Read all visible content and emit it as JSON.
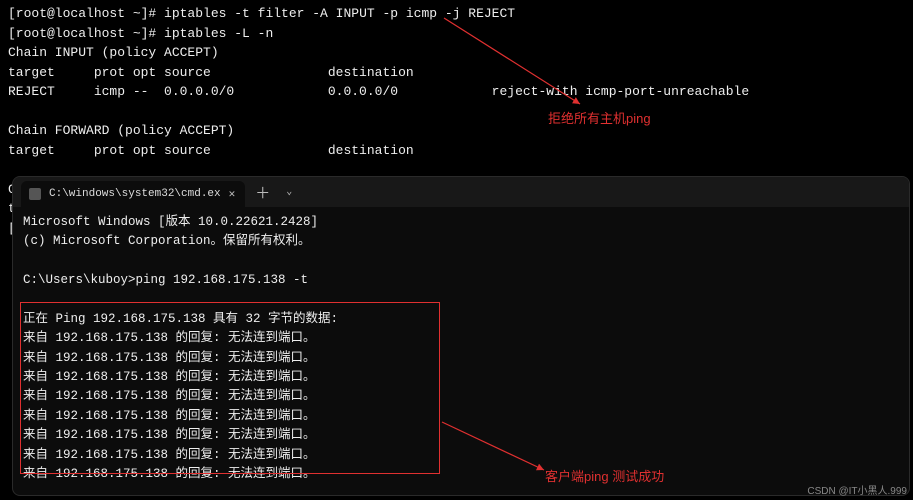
{
  "linux": {
    "prompt_user": "[root@localhost ~]# ",
    "cmd1": "iptables -t filter -A INPUT -p icmp -j REJECT",
    "cmd2": "iptables -L -n",
    "chain_input": "Chain INPUT (policy ACCEPT)",
    "header": "target     prot opt source               destination",
    "rule1": "REJECT     icmp --  0.0.0.0/0            0.0.0.0/0            reject-with icmp-port-unreachable",
    "chain_forward": "Chain FORWARD (policy ACCEPT)",
    "header2": "target     prot opt source               destination",
    "chain_output": "Chain OUTPUT (policy ACCEPT)",
    "trunc1": "ta",
    "trunc2": "["
  },
  "win": {
    "tab_title": "C:\\windows\\system32\\cmd.ex",
    "ver": "Microsoft Windows [版本 10.0.22621.2428]",
    "copy": "(c) Microsoft Corporation。保留所有权利。",
    "prompt": "C:\\Users\\kuboy>",
    "cmd": "ping 192.168.175.138 -t",
    "ping_start": "正在 Ping 192.168.175.138 具有 32 字节的数据:",
    "replies": [
      "来自 192.168.175.138 的回复: 无法连到端口。",
      "来自 192.168.175.138 的回复: 无法连到端口。",
      "来自 192.168.175.138 的回复: 无法连到端口。",
      "来自 192.168.175.138 的回复: 无法连到端口。",
      "来自 192.168.175.138 的回复: 无法连到端口。",
      "来自 192.168.175.138 的回复: 无法连到端口。",
      "来自 192.168.175.138 的回复: 无法连到端口。",
      "来自 192.168.175.138 的回复: 无法连到端口。"
    ]
  },
  "annot": {
    "label1": "拒绝所有主机ping",
    "label2": "客户端ping 测试成功"
  },
  "watermark": "CSDN @IT小黑人.999"
}
